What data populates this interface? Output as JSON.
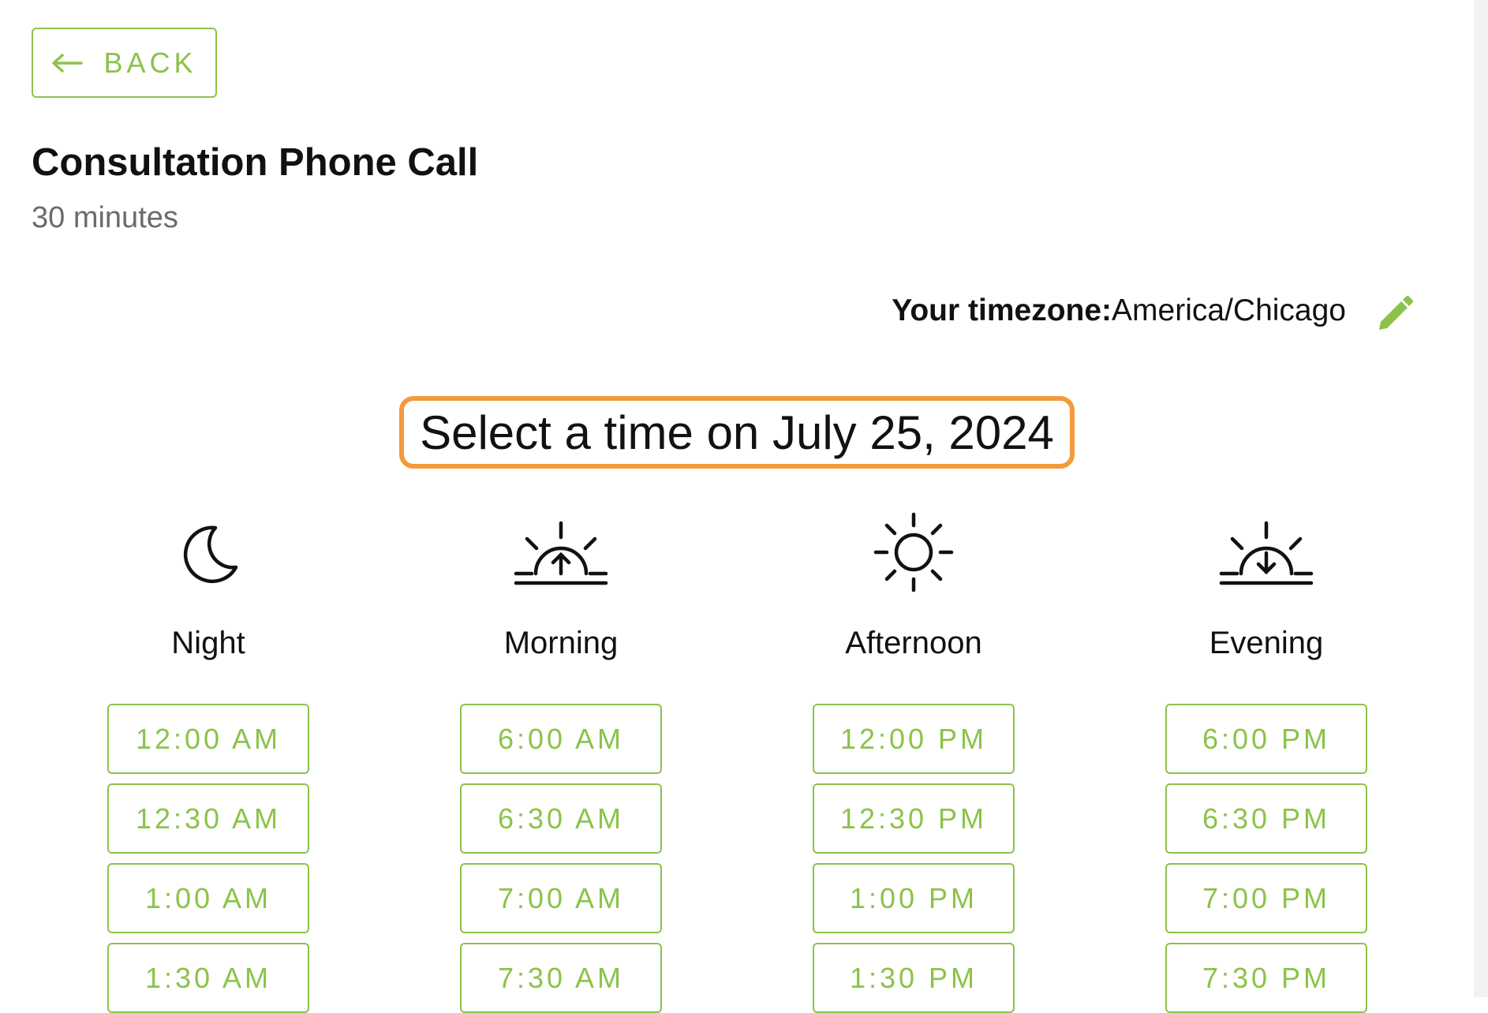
{
  "back_button": {
    "label": "BACK"
  },
  "event": {
    "title": "Consultation Phone Call",
    "duration": "30 minutes"
  },
  "timezone": {
    "label": "Your timezone:",
    "value": "America/Chicago"
  },
  "date_heading": "Select a time on July 25, 2024",
  "colors": {
    "accent": "#8bc34a",
    "highlight": "#f39a3c",
    "text": "#111111",
    "muted": "#6b6b6b"
  },
  "columns": [
    {
      "icon": "moon-icon",
      "label": "Night",
      "slots": [
        "12:00 AM",
        "12:30 AM",
        "1:00 AM",
        "1:30 AM"
      ]
    },
    {
      "icon": "sunrise-icon",
      "label": "Morning",
      "slots": [
        "6:00 AM",
        "6:30 AM",
        "7:00 AM",
        "7:30 AM"
      ]
    },
    {
      "icon": "sun-icon",
      "label": "Afternoon",
      "slots": [
        "12:00 PM",
        "12:30 PM",
        "1:00 PM",
        "1:30 PM"
      ]
    },
    {
      "icon": "sunset-icon",
      "label": "Evening",
      "slots": [
        "6:00 PM",
        "6:30 PM",
        "7:00 PM",
        "7:30 PM"
      ]
    }
  ]
}
